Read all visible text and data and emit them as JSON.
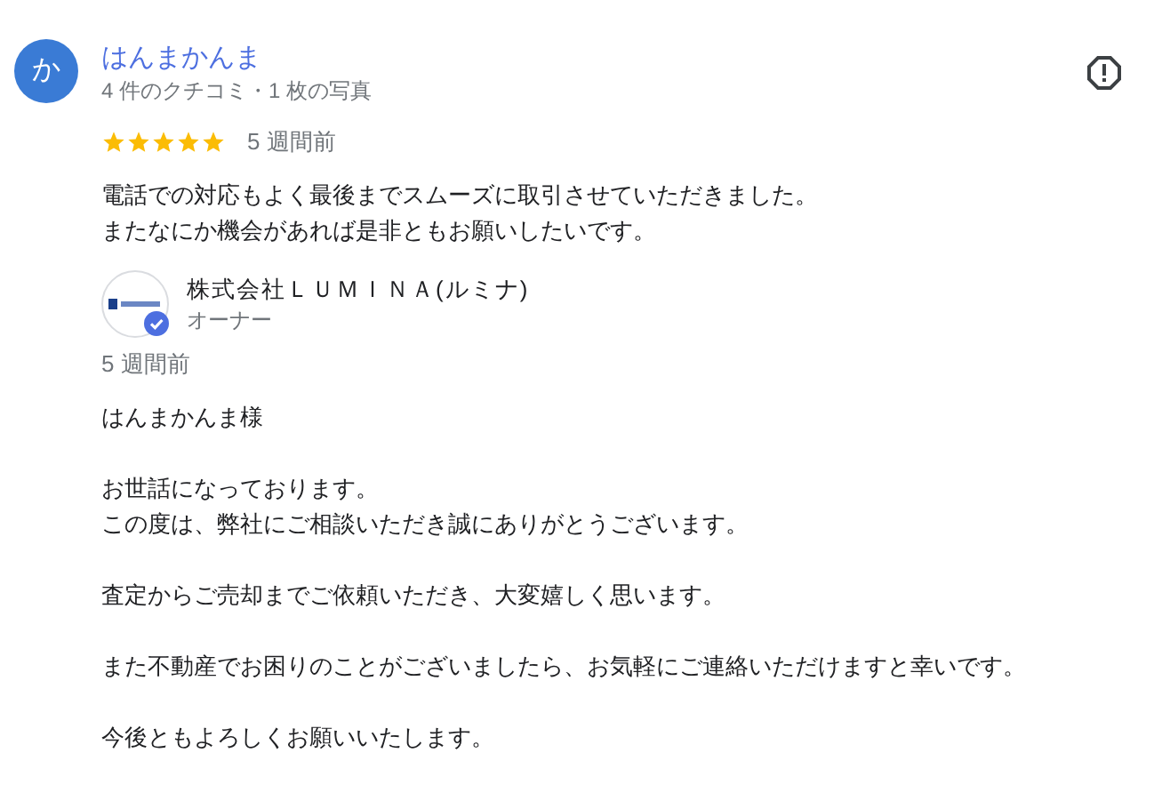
{
  "review": {
    "avatar_letter": "か",
    "author": "はんまかんま",
    "meta": "4 件のクチコミ・1 枚の写真",
    "stars": 5,
    "time": "5 週間前",
    "paragraphs": [
      [
        "電話での対応もよく最後までスムーズに取引させていただきました。",
        "またなにか機会があれば是非ともお願いしたいです。"
      ]
    ]
  },
  "owner_reply": {
    "name": "株式会社ＬＵＭＩＮＡ(ルミナ)",
    "role": "オーナー",
    "verified": true,
    "time": "5 週間前",
    "paragraphs": [
      [
        "はんまかんま様"
      ],
      [
        "お世話になっております。",
        "この度は、弊社にご相談いただき誠にありがとうございます。"
      ],
      [
        "査定からご売却までご依頼いただき、大変嬉しく思います。"
      ],
      [
        "また不動産でお困りのことがございましたら、お気軽にご連絡いただけますと幸いです。"
      ],
      [
        "今後ともよろしくお願いいたします。"
      ]
    ]
  }
}
